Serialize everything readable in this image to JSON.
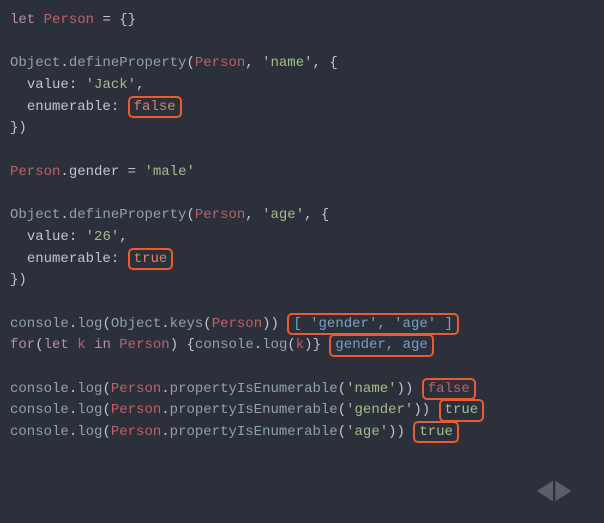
{
  "code": {
    "l1": {
      "let": "let",
      "Person": "Person",
      "eq": "=",
      "ob": "{",
      "cb": "}"
    },
    "l3": {
      "Object": "Object",
      "defineProperty": "defineProperty",
      "name": "'name'"
    },
    "l4": {
      "jack": "'Jack'"
    },
    "l8": {
      "gender": "gender",
      "male": "'male'"
    },
    "l10": {
      "age": "'age'"
    },
    "l11": {
      "v26": "'26'"
    },
    "Object": "Object",
    "defineProperty": "defineProperty",
    "Person": "Person",
    "console": "console",
    "log": "log",
    "keys": "keys",
    "pie": "propertyIsEnumerable",
    "value": "value",
    "enumerable": "enumerable",
    "true": "true",
    "false": "false",
    "for": "for",
    "let": "let",
    "in": "in",
    "k": "k",
    "sgender": "'gender'",
    "dot": ".",
    "comma": ",",
    "colon": ":",
    "eq": "=",
    "op": "(",
    "cp": ")",
    "ob": "{",
    "cb": "}"
  },
  "output": {
    "keys": "[ 'gender', 'age' ]",
    "forin": "gender, age",
    "f": "false",
    "t": "true"
  },
  "highlights": [
    "enumerable-false",
    "enumerable-true",
    "output-keys-array",
    "output-forin",
    "output-pie-name-false",
    "output-pie-gender-true",
    "output-pie-age-true"
  ]
}
